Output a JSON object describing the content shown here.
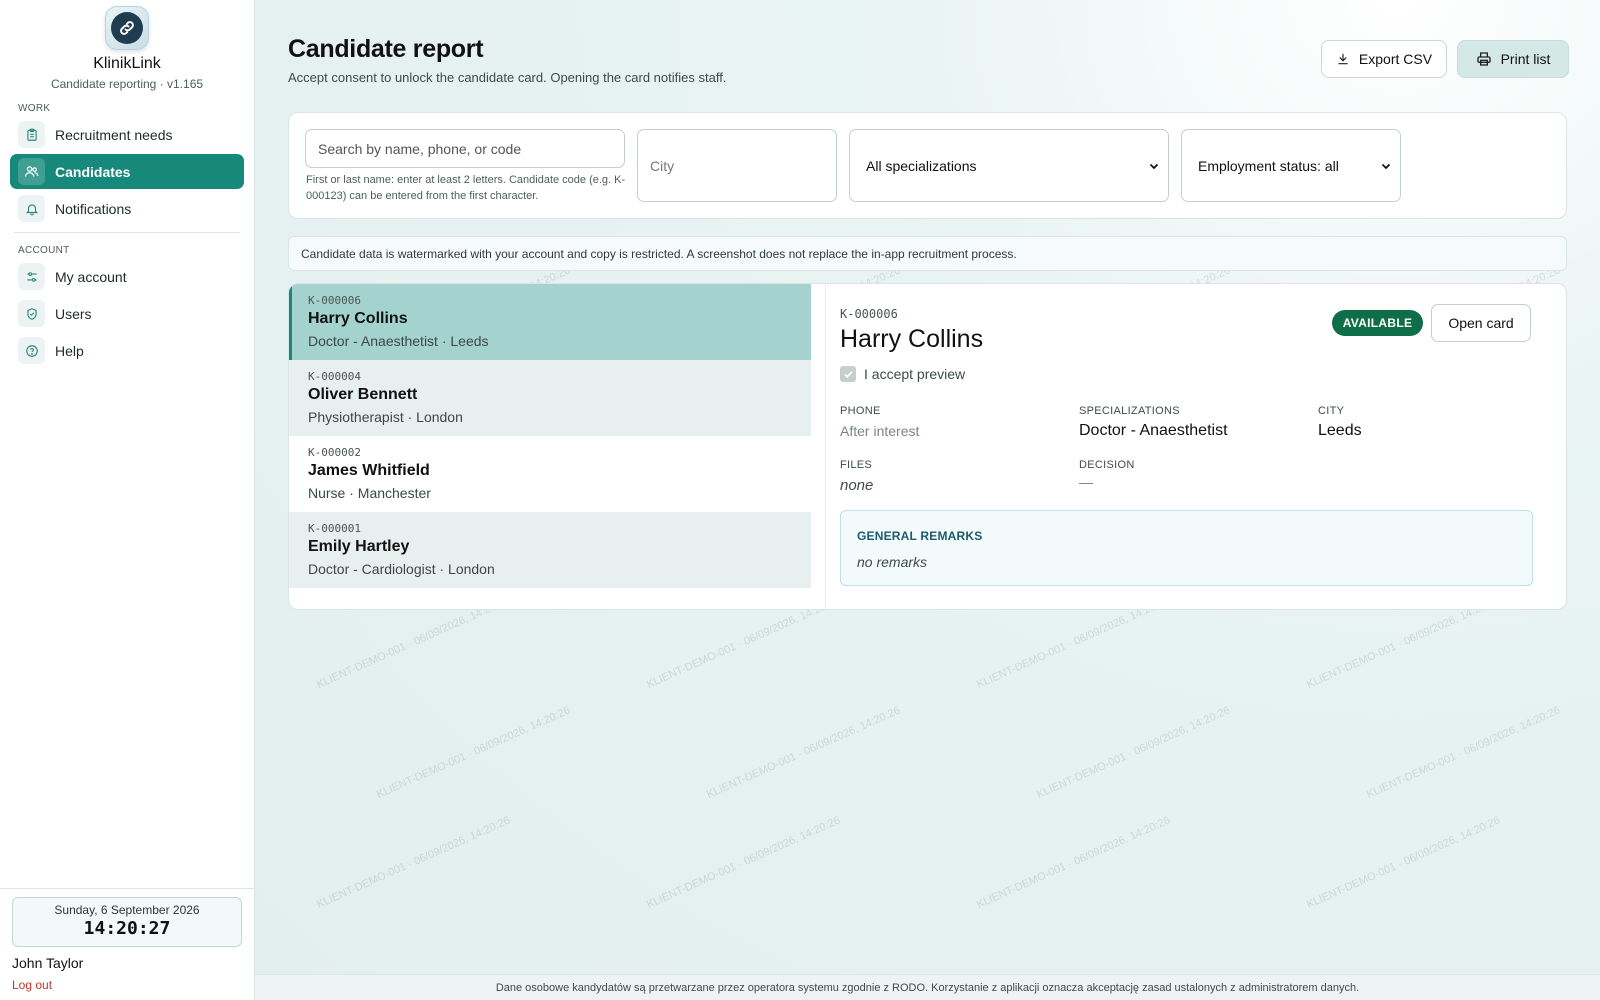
{
  "app": {
    "name": "KlinikLink",
    "subtitle": "Candidate reporting · v1.165"
  },
  "sidebar": {
    "sections": [
      {
        "title": "WORK"
      },
      {
        "title": "ACCOUNT"
      }
    ],
    "items": [
      {
        "label": "Recruitment needs",
        "icon": "clipboard-icon",
        "active": false
      },
      {
        "label": "Candidates",
        "icon": "users-icon",
        "active": true
      },
      {
        "label": "Notifications",
        "icon": "bell-icon",
        "active": false
      },
      {
        "label": "My account",
        "icon": "sliders-icon",
        "active": false
      },
      {
        "label": "Users",
        "icon": "shield-check-icon",
        "active": false
      },
      {
        "label": "Help",
        "icon": "help-circle-icon",
        "active": false
      }
    ],
    "clock": {
      "date": "Sunday, 6 September 2026",
      "time": "14:20:27"
    },
    "user": {
      "name": "John Taylor",
      "logout": "Log out"
    }
  },
  "header": {
    "title": "Candidate report",
    "subtitle": "Accept consent to unlock the candidate card. Opening the card notifies staff.",
    "export_label": "Export CSV",
    "print_label": "Print list"
  },
  "filters": {
    "search_placeholder": "Search by name, phone, or code",
    "search_hint": "First or last name: enter at least 2 letters. Candidate code (e.g. K-000123) can be entered from the first character.",
    "city_placeholder": "City",
    "specialization_value": "All specializations",
    "status_value": "Employment status: all"
  },
  "notice": "Candidate data is watermarked with your account and copy is restricted. A screenshot does not replace the in-app recruitment process.",
  "candidates": [
    {
      "code": "K-000006",
      "name": "Harry Collins",
      "meta": "Doctor - Anaesthetist · Leeds",
      "selected": true
    },
    {
      "code": "K-000004",
      "name": "Oliver Bennett",
      "meta": "Physiotherapist · London",
      "selected": false
    },
    {
      "code": "K-000002",
      "name": "James Whitfield",
      "meta": "Nurse · Manchester",
      "selected": false
    },
    {
      "code": "K-000001",
      "name": "Emily Hartley",
      "meta": "Doctor - Cardiologist · London",
      "selected": false
    }
  ],
  "detail": {
    "code": "K-000006",
    "name": "Harry Collins",
    "status_badge": "AVAILABLE",
    "open_card_label": "Open card",
    "consent_label": "I accept preview",
    "consent_checked": true,
    "phone_label": "PHONE",
    "phone_value": "After interest",
    "specializations_label": "SPECIALIZATIONS",
    "specializations_value": "Doctor - Anaesthetist",
    "city_label": "CITY",
    "city_value": "Leeds",
    "files_label": "FILES",
    "files_value": "none",
    "decision_label": "DECISION",
    "decision_value": "—",
    "remarks_title": "GENERAL REMARKS",
    "remarks_value": "no remarks"
  },
  "watermark_text": "KLIENT-DEMO-001 · 06/09/2026, 14:20:26",
  "footer": "Dane osobowe kandydatów są przetwarzane przez operatora systemu zgodnie z RODO. Korzystanie z aplikacji oznacza akceptację zasad ustalonych z administratorem danych.",
  "colors": {
    "accent": "#17897a",
    "selected_row": "#a4d3cf",
    "badge": "#0f6e4a",
    "logout": "#c0392b"
  }
}
